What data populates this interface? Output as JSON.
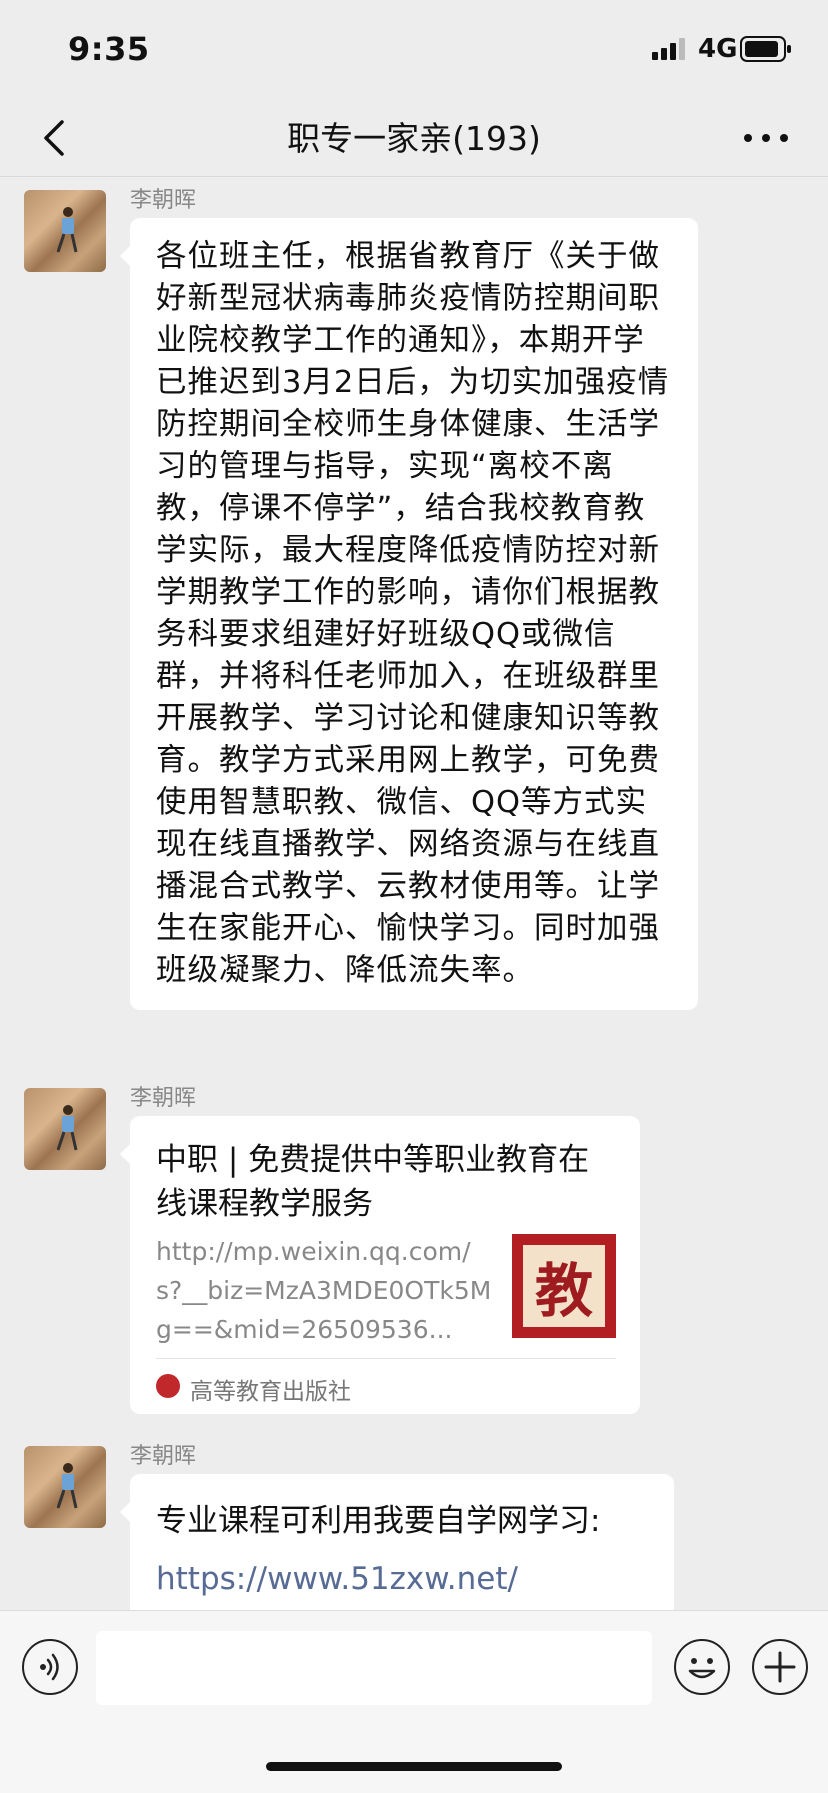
{
  "status_bar": {
    "time": "9:35",
    "network": "4G"
  },
  "nav": {
    "title": "职专一家亲(193)"
  },
  "messages": [
    {
      "sender": "李朝晖",
      "text": "各位班主任，根据省教育厅《关于做好新型冠状病毒肺炎疫情防控期间职业院校教学工作的通知》，本期开学已推迟到3月2日后，为切实加强疫情防控期间全校师生身体健康、生活学习的管理与指导，实现“离校不离教，停课不停学”，结合我校教育教学实际，最大程度降低疫情防控对新学期教学工作的影响，请你们根据教务科要求组建好好班级QQ或微信群，并将科任老师加入，在班级群里开展教学、学习讨论和健康知识等教育。教学方式采用网上教学，可免费使用智慧职教、微信、QQ等方式实现在线直播教学、网络资源与在线直播混合式教学、云教材使用等。让学生在家能开心、愉快学习。同时加强班级凝聚力、降低流失率。"
    },
    {
      "sender": "李朝晖",
      "link_title": "中职 | 免费提供中等职业教育在线课程教学服务",
      "link_url": "http://mp.weixin.qq.com/s?__biz=MzA3MDE0OTk5Mg==&mid=26509536...",
      "thumb_char": "教",
      "source": "高等教育出版社"
    },
    {
      "sender": "李朝晖",
      "text": "专业课程可利用我要自学网学习:",
      "url": "https://www.51zxw.net/"
    }
  ],
  "icons": [
    "back-icon",
    "more-icon",
    "voice-icon",
    "emoji-icon",
    "plus-icon"
  ]
}
